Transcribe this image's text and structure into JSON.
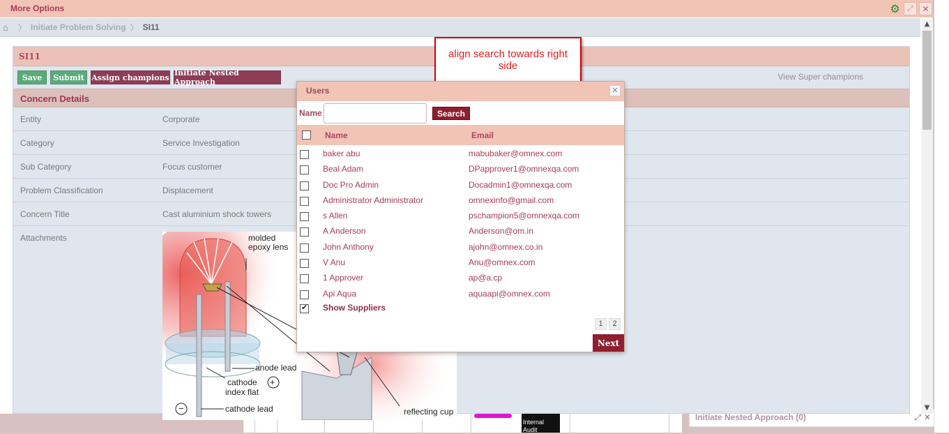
{
  "window": {
    "title": "More Options"
  },
  "breadcrumb": {
    "items": [
      "Initiate Problem Solving"
    ],
    "current": "SI11"
  },
  "panel": {
    "title": "SI11"
  },
  "actions": {
    "save": "Save",
    "submit": "Submit",
    "assign": "Assign champions",
    "nested": "Initiate Nested Approach",
    "view_super": "View Super champions"
  },
  "section": {
    "title": "Concern Details"
  },
  "fields": [
    {
      "label": "Entity",
      "value": "Corporate"
    },
    {
      "label": "Category",
      "value": "Service Investigation"
    },
    {
      "label": "Sub Category",
      "value": "Focus customer"
    },
    {
      "label": "Problem Classification",
      "value": "Displacement"
    },
    {
      "label": "Concern Title",
      "value": "Cast aluminium shock towers"
    },
    {
      "label": "Attachments",
      "value": ""
    }
  ],
  "image_labels": {
    "lens": "molded\nepoxy lens",
    "anode": "anode lead",
    "cathode_flat": "cathode\nindex flat",
    "cathode": "cathode lead",
    "cup": "reflecting cup",
    "plus": "+",
    "minus": "−"
  },
  "annotation": {
    "text": "align search towards right side"
  },
  "modal": {
    "title": "Users",
    "search_label": "Name",
    "search_value": "",
    "search_button": "Search",
    "col_name": "Name",
    "col_email": "Email",
    "users": [
      {
        "name": "baker abu",
        "email": "mabubaker@omnex.com"
      },
      {
        "name": "Beal Adam",
        "email": "DPapprover1@omnexqa.com"
      },
      {
        "name": "Doc Pro Admin",
        "email": "Docadmin1@omnexqa.com"
      },
      {
        "name": "Administrator Administrator",
        "email": "omnexinfo@gmail.com"
      },
      {
        "name": "s Allen",
        "email": "pschampion5@omnexqa.com"
      },
      {
        "name": "A Anderson",
        "email": "Anderson@om.in"
      },
      {
        "name": "John Anthony",
        "email": "ajohn@omnex.co.in"
      },
      {
        "name": "V Anu",
        "email": "Anu@omnex.com"
      },
      {
        "name": "1 Approver",
        "email": "ap@a.cp"
      },
      {
        "name": "Api Aqua",
        "email": "aquaapi@omnex.com"
      }
    ],
    "show_suppliers": "Show Suppliers",
    "pages": [
      "1",
      "2"
    ],
    "next": "Next"
  },
  "background": {
    "nested_panel": "Initiate Nested Approach (0)",
    "internal_audit": "Internal\nAudit"
  }
}
